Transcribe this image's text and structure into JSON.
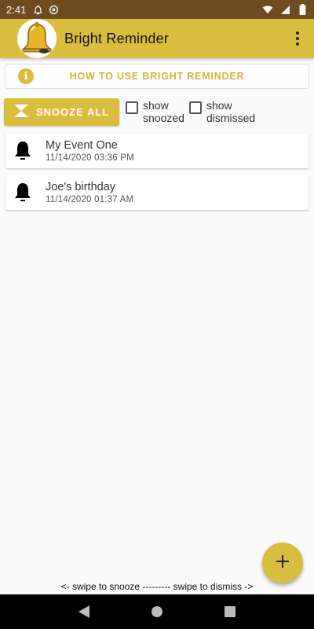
{
  "status_bar": {
    "time": "2:41",
    "icons": [
      "notification-bell-icon",
      "vpn-icon",
      "wifi-icon",
      "signal-icon",
      "battery-icon"
    ]
  },
  "app_bar": {
    "title": "Bright Reminder",
    "logo_icon": "bell-logo-icon",
    "menu_icon": "overflow-menu-icon"
  },
  "howto": {
    "label": "HOW TO USE BRIGHT REMINDER",
    "icon": "info-icon",
    "icon_glyph": "i"
  },
  "controls": {
    "snooze_all_label": "SNOOZE ALL",
    "snooze_icon": "hourglass-icon",
    "show_snoozed": {
      "line1": "show",
      "line2": "snoozed",
      "checked": false
    },
    "show_dismissed": {
      "line1": "show",
      "line2": "dismissed",
      "checked": false
    }
  },
  "events": [
    {
      "title": "My Event One",
      "datetime": "11/14/2020 03:36 PM",
      "icon": "bell-icon"
    },
    {
      "title": "Joe's birthday",
      "datetime": "11/14/2020 01:37 AM",
      "icon": "bell-icon"
    }
  ],
  "fab": {
    "icon": "plus-icon",
    "glyph": "+"
  },
  "hint": "<- swipe to snooze --------- swipe to dismiss ->",
  "nav_bar": {
    "icons": [
      "back-icon",
      "home-icon",
      "recents-icon"
    ]
  },
  "colors": {
    "accent": "#d9bd3f",
    "status_bar": "#6e4c1f",
    "accent_text": "#d4b43a"
  }
}
